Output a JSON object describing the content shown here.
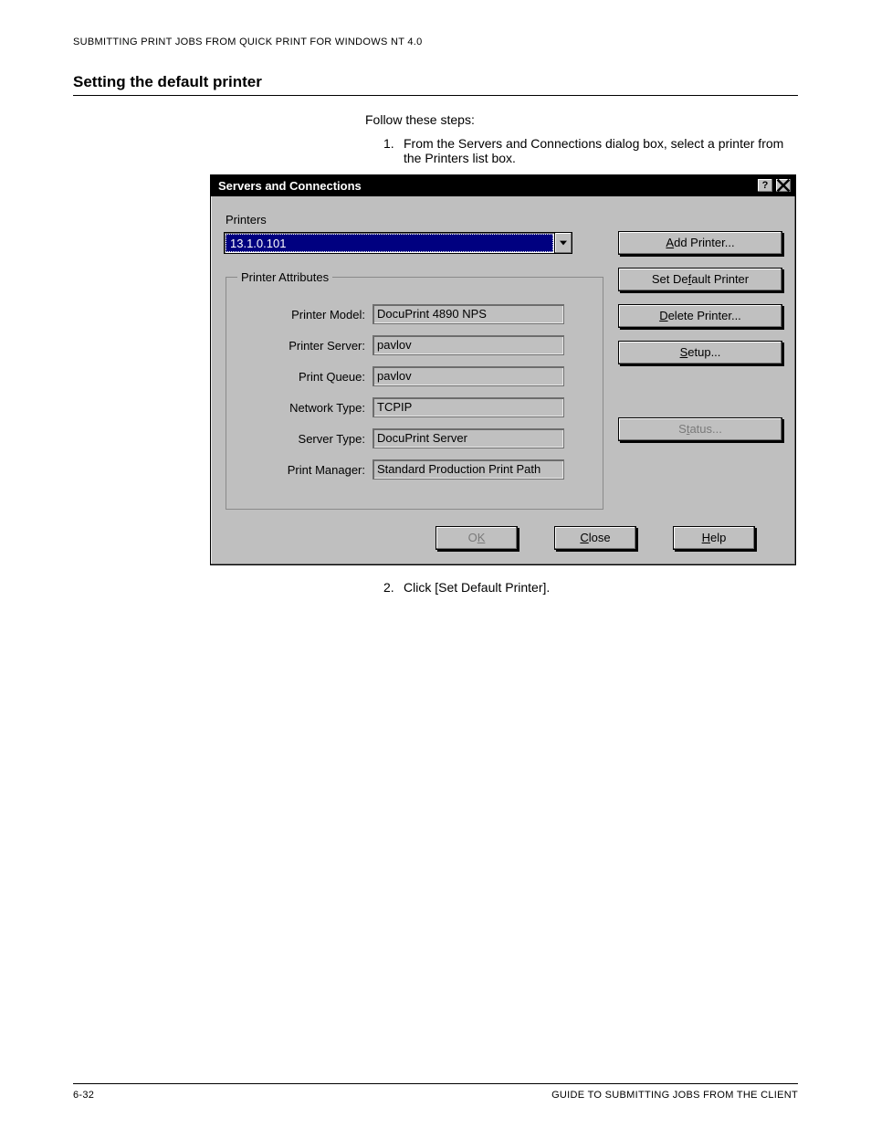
{
  "header": "SUBMITTING PRINT JOBS FROM QUICK PRINT FOR WINDOWS NT 4.0",
  "section_title": "Setting the default printer",
  "intro": "Follow these steps:",
  "step1_num": "1.",
  "step1": "From the Servers and Connections dialog box, select a printer from the Printers list box.",
  "step2_num": "2.",
  "step2": "Click [Set Default Printer].",
  "dialog": {
    "title": "Servers and Connections",
    "printers_label": "Printers",
    "dropdown_value": "13.1.0.101",
    "fieldset_legend": "Printer Attributes",
    "attrs": {
      "model_label": "Printer Model:",
      "model_value": "DocuPrint 4890 NPS",
      "server_label": "Printer Server:",
      "server_value": "pavlov",
      "queue_label": "Print Queue:",
      "queue_value": "pavlov",
      "network_label": "Network Type:",
      "network_value": "TCPIP",
      "stype_label": "Server Type:",
      "stype_value": "DocuPrint Server",
      "pmgr_label": "Print Manager:",
      "pmgr_value": "Standard Production Print Path"
    },
    "buttons": {
      "add": "Add Printer...",
      "setdef": "Set Default Printer",
      "delete": "Delete Printer...",
      "setup": "Setup...",
      "status": "Status...",
      "ok": "OK",
      "close": "Close",
      "help": "Help"
    }
  },
  "footer": {
    "left": "6-32",
    "right": "GUIDE TO SUBMITTING JOBS FROM THE CLIENT"
  }
}
